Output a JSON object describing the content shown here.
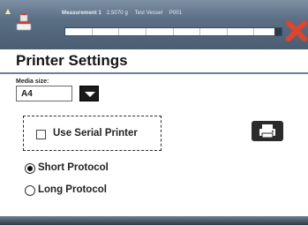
{
  "header": {
    "measurement_label": "Measurement 1",
    "weight": "2.5070 g",
    "vessel_label": "Test Vessel",
    "vessel_value": "P001",
    "progress": 0.97
  },
  "page": {
    "title": "Printer Settings"
  },
  "media": {
    "label": "Media size:",
    "value": "A4"
  },
  "serial": {
    "label": "Use Serial Printer",
    "checked": false
  },
  "protocol": {
    "options": [
      {
        "label": "Short Protocol",
        "selected": true
      },
      {
        "label": "Long Protocol",
        "selected": false
      }
    ]
  },
  "colors": {
    "header_bg": "#5a6e84",
    "close_x": "#e0442a",
    "accent_rule": "#6c7f94"
  }
}
